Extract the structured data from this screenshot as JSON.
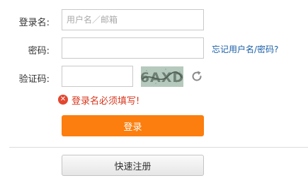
{
  "form": {
    "username_label": "登录名:",
    "username_placeholder": "用户名／邮箱",
    "username_value": "",
    "password_label": "密码:",
    "password_value": "",
    "forgot_link": "忘记用户名/密码?",
    "captcha_label": "验证码:",
    "captcha_value": "",
    "captcha_text": "6AXD",
    "error_message": "登录名必须填写!",
    "login_button": "登录",
    "register_button": "快速注册"
  },
  "colors": {
    "accent": "#fb7e0e",
    "error": "#d8361d",
    "link": "#1a5fa8"
  },
  "icons": {
    "captcha": "captcha-image",
    "refresh": "refresh-icon",
    "error": "error-circle-icon"
  }
}
